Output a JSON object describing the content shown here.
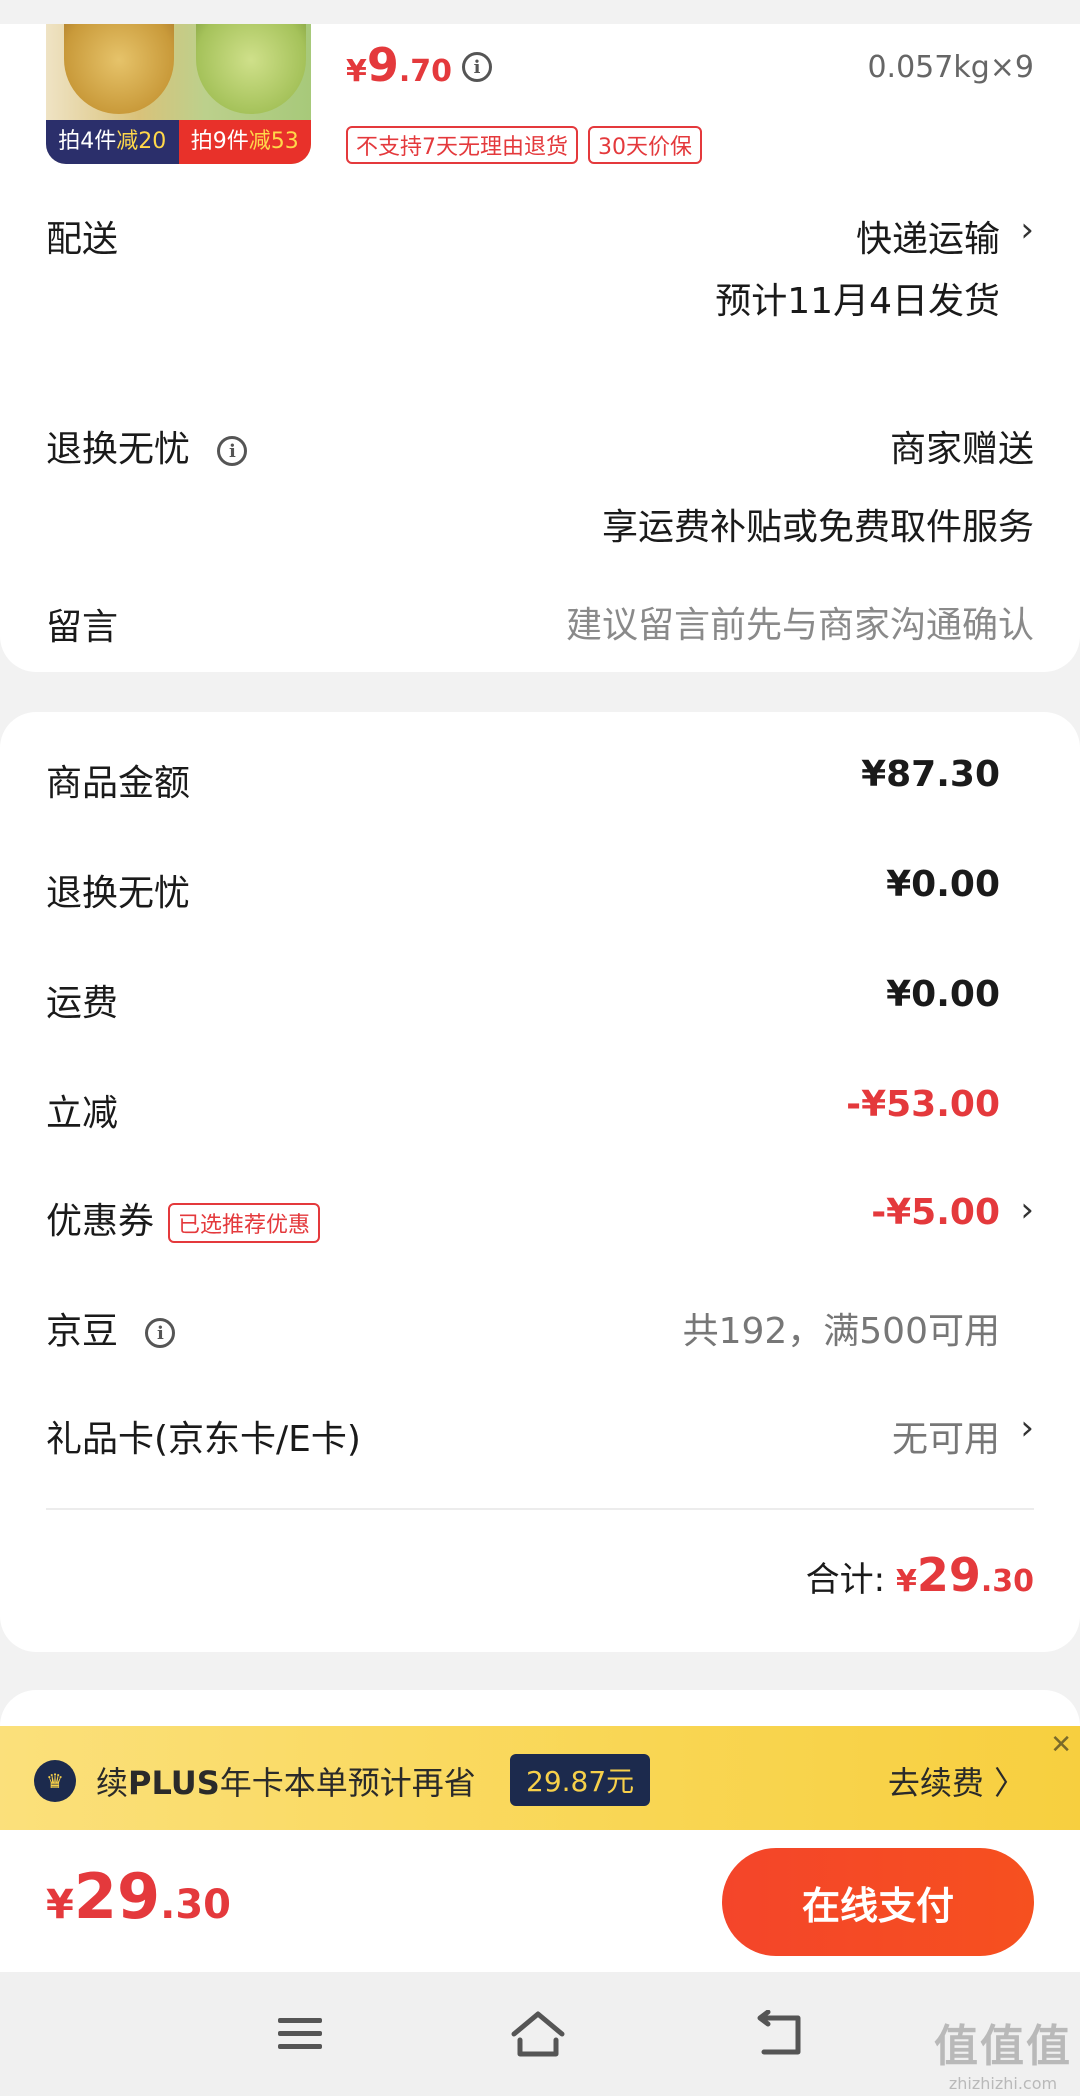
{
  "product": {
    "promo_left_prefix": "拍4件",
    "promo_left_highlight": "减20",
    "promo_right_prefix": "拍9件",
    "promo_right_highlight": "减53",
    "price_currency": "¥",
    "price_int": "9",
    "price_dec": ".70",
    "weight": "0.057kg×9",
    "tags": [
      "不支持7天无理由退货",
      "30天价保"
    ]
  },
  "delivery": {
    "label": "配送",
    "method": "快递运输",
    "eta": "预计11月4日发货"
  },
  "return_service": {
    "label": "退换无忧",
    "value": "商家赠送",
    "desc": "享运费补贴或免费取件服务"
  },
  "message": {
    "label": "留言",
    "placeholder": "建议留言前先与商家沟通确认"
  },
  "summary": {
    "goods_label": "商品金额",
    "goods_value": "¥87.30",
    "return_label": "退换无忧",
    "return_value": "¥0.00",
    "shipping_label": "运费",
    "shipping_value": "¥0.00",
    "discount_label": "立减",
    "discount_value": "-¥53.00",
    "coupon_label": "优惠券",
    "coupon_tag": "已选推荐优惠",
    "coupon_value": "-¥5.00",
    "beans_label": "京豆",
    "beans_value": "共192，满500可用",
    "giftcard_label": "礼品卡(京东卡/E卡)",
    "giftcard_value": "无可用",
    "total_label": "合计:",
    "total_currency": "¥",
    "total_int": "29",
    "total_dec": ".30"
  },
  "plus_banner": {
    "text_prefix": "续",
    "text_bold": "PLUS",
    "text_suffix": "年卡本单预计再省",
    "save_amount": "29.87元",
    "renew_label": "去续费 〉",
    "close": "✕"
  },
  "checkout": {
    "currency": "¥",
    "int": "29",
    "dec": ".30",
    "pay_label": "在线支付"
  },
  "watermark": {
    "logo_text": "值值值",
    "site": "zhizhizhi.com"
  },
  "colors": {
    "accent_red": "#e4393c",
    "plus_yellow": "#f9d653",
    "plus_navy": "#1c2a4d"
  }
}
